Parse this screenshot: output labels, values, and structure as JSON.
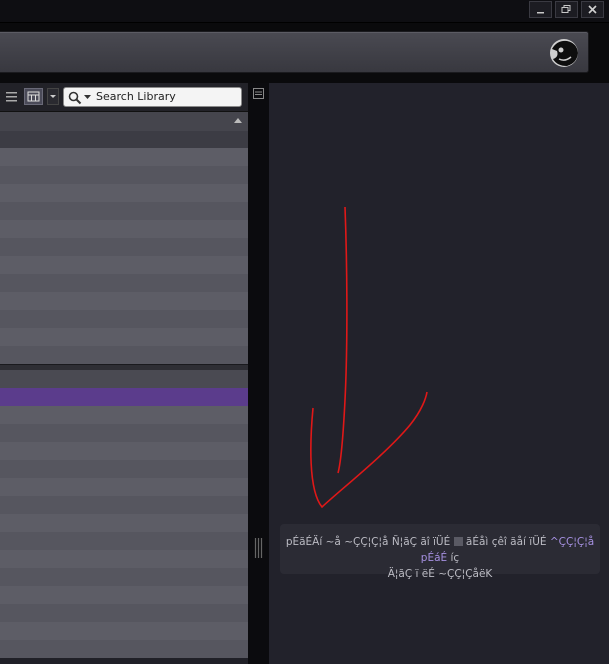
{
  "window": {
    "controls": [
      "minimize",
      "restore",
      "close"
    ]
  },
  "library": {
    "search_placeholder": "Search Library"
  },
  "message": {
    "line1_prefix": "pÉãÉÄí ~å ~ÇÇ¦Ç¦å Ñ¦ãÇ ãî ïÜÉ ",
    "line1_middle": " ãÉåì çêî ãåí ïÜÉ ",
    "line1_link": "^ÇÇ¦Ç¦å pÉáÉ",
    "line1_suffix": " íç",
    "line2": "Ä¦ãÇ ï ëÉ ~ÇÇ¦ÇåëK"
  },
  "colors": {
    "selected_row": "#5b3c8c",
    "annotation_arrow": "#e01818",
    "link": "#a590e0"
  },
  "icons": [
    "minimize-icon",
    "restore-icon",
    "close-icon",
    "logo-icon",
    "list-view-icon",
    "details-view-icon",
    "search-icon",
    "chevron-down-icon",
    "sort-ascending-icon",
    "list-pane-icon",
    "grip-icon"
  ]
}
